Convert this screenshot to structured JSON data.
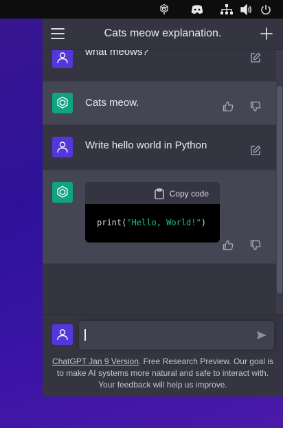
{
  "header": {
    "title": "Cats meow explanation."
  },
  "tray": {
    "icons": [
      "chatgpt-logo-icon",
      "discord-icon",
      "network-icon",
      "volume-icon",
      "power-icon"
    ]
  },
  "messages": [
    {
      "role": "user",
      "text": "what meows?"
    },
    {
      "role": "assistant",
      "text": "Cats meow."
    },
    {
      "role": "user",
      "text": "Write hello world in Python"
    },
    {
      "role": "assistant",
      "code": {
        "copy_label": "Copy code",
        "fn": "print",
        "open": "(",
        "string": "\"Hello, World!\"",
        "close": ")"
      }
    }
  ],
  "input": {
    "value": "",
    "placeholder": ""
  },
  "footer": {
    "link_text": "ChatGPT Jan 9 Version",
    "text": ". Free Research Preview. Our goal is to make AI systems more natural and safe to interact with. Your feedback will help us improve."
  },
  "colors": {
    "user_avatar": "#5436da",
    "bot_avatar": "#10a37f",
    "background": "#343541",
    "bot_row": "#444654"
  }
}
